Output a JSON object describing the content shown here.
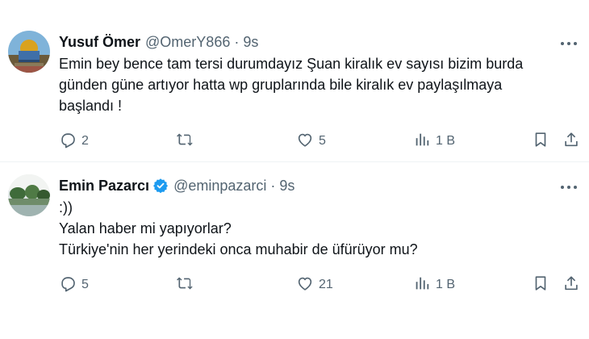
{
  "tweets": [
    {
      "author": {
        "name": "Yusuf Ömer",
        "handle": "@OmerY866",
        "time": "9s",
        "verified": false
      },
      "lines": [
        "Emin bey bence tam tersi durumdayız Şuan kiralık ev sayısı bizim burda",
        "günden güne artıyor hatta wp gruplarında bile kiralık ev paylaşılmaya",
        "başlandı !"
      ],
      "metrics": {
        "replies": "2",
        "retweets": "",
        "likes": "5",
        "views": "1 B"
      }
    },
    {
      "author": {
        "name": "Emin Pazarcı",
        "handle": "@eminpazarci",
        "time": "9s",
        "verified": true
      },
      "lines": [
        ":))",
        "Yalan haber mi yapıyorlar?",
        "Türkiye'nin her yerindeki onca muhabir de üfürüyor mu?"
      ],
      "metrics": {
        "replies": "5",
        "retweets": "",
        "likes": "21",
        "views": "1 B"
      }
    }
  ],
  "separator": "·",
  "icons": {
    "reply": "reply-icon",
    "retweet": "retweet-icon",
    "like": "heart-icon",
    "views": "views-icon",
    "bookmark": "bookmark-icon",
    "share": "share-icon",
    "more": "more-icon",
    "verified": "verified-badge-icon"
  },
  "colors": {
    "text": "#0f1419",
    "secondary": "#536471",
    "verified": "#1d9bf0",
    "divider": "#eff3f4"
  }
}
